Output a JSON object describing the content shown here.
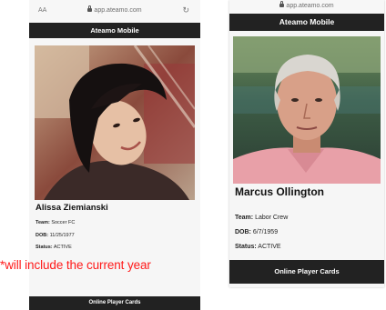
{
  "left_phone": {
    "browser": {
      "text_size_label": "AA",
      "url": "app.ateamo.com",
      "reload_icon": "reload-icon"
    },
    "header": {
      "title": "Ateamo Mobile"
    },
    "player": {
      "name": "Alissa Ziemianski",
      "team_label": "Team:",
      "team": "Soccer FC",
      "dob_label": "DOB:",
      "dob": "11/25/1977",
      "status_label": "Status:",
      "status": "ACTIVE"
    },
    "footer": {
      "label": "Online Player Cards"
    }
  },
  "right_phone": {
    "browser": {
      "url": "app.ateamo.com"
    },
    "header": {
      "title": "Ateamo Mobile"
    },
    "player": {
      "name": "Marcus Ollington",
      "team_label": "Team:",
      "team": "Labor Crew",
      "dob_label": "DOB:",
      "dob": "6/7/1959",
      "status_label": "Status:",
      "status": "ACTIVE"
    },
    "footer": {
      "label": "Online Player Cards"
    }
  },
  "annotation": {
    "text": "*will include the current year",
    "color": "#ff1a1a"
  },
  "colors": {
    "header_bg": "#222222",
    "header_text": "#ffffff"
  }
}
